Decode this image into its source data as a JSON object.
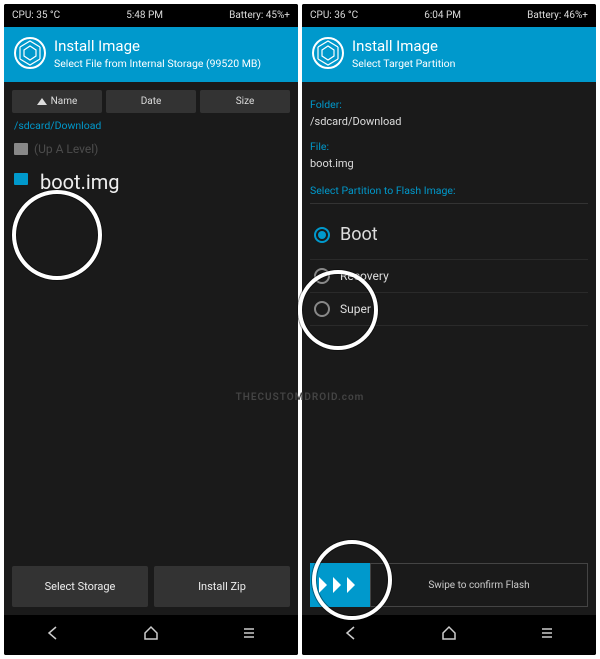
{
  "watermark": "THECUSTOMDROID.com",
  "left": {
    "status": {
      "cpu": "CPU: 35 °C",
      "time": "5:48 PM",
      "battery": "Battery: 45%+"
    },
    "header": {
      "title": "Install Image",
      "subtitle": "Select File from Internal Storage (99520 MB)"
    },
    "sort": {
      "name": "Name",
      "date": "Date",
      "size": "Size"
    },
    "path": "/sdcard/Download",
    "folder_up": "(Up A Level)",
    "file": "boot.img",
    "buttons": {
      "storage": "Select Storage",
      "zip": "Install Zip"
    }
  },
  "right": {
    "status": {
      "cpu": "CPU: 36 °C",
      "time": "6:04 PM",
      "battery": "Battery: 46%+"
    },
    "header": {
      "title": "Install Image",
      "subtitle": "Select Target Partition"
    },
    "labels": {
      "folder": "Folder:",
      "file": "File:",
      "select": "Select Partition to Flash Image:"
    },
    "values": {
      "folder": "/sdcard/Download",
      "file": "boot.img"
    },
    "partitions": [
      {
        "label": "Boot",
        "checked": true
      },
      {
        "label": "Recovery",
        "checked": false
      },
      {
        "label": "Super",
        "checked": false
      }
    ],
    "swipe": "Swipe to confirm Flash"
  }
}
